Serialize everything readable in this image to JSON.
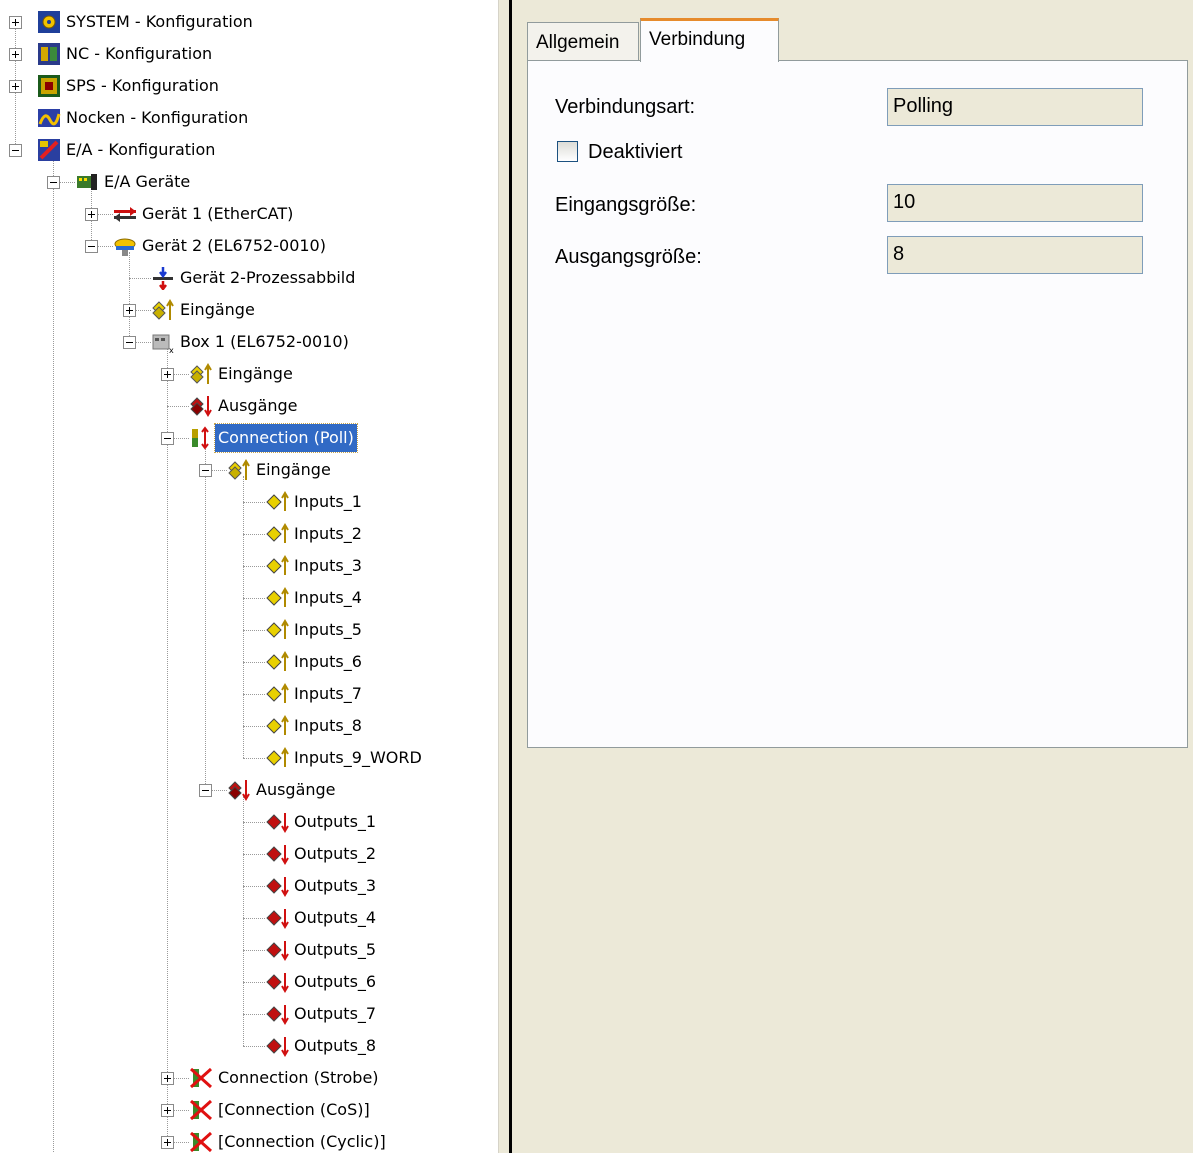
{
  "tree": {
    "items": [
      {
        "label": "SYSTEM - Konfiguration",
        "icon": "system-config-icon",
        "expander": "plus"
      },
      {
        "label": "NC - Konfiguration",
        "icon": "nc-config-icon",
        "expander": "plus"
      },
      {
        "label": "SPS - Konfiguration",
        "icon": "sps-config-icon",
        "expander": "plus"
      },
      {
        "label": "Nocken - Konfiguration",
        "icon": "cam-config-icon",
        "expander": "none"
      },
      {
        "label": "E/A - Konfiguration",
        "icon": "io-config-icon",
        "expander": "minus"
      },
      {
        "label": "E/A Geräte",
        "icon": "io-devices-icon",
        "expander": "minus"
      },
      {
        "label": "Gerät 1 (EtherCAT)",
        "icon": "ethercat-device-icon",
        "expander": "plus"
      },
      {
        "label": "Gerät 2 (EL6752-0010)",
        "icon": "devicenet-device-icon",
        "expander": "minus"
      },
      {
        "label": "Gerät 2-Prozessabbild",
        "icon": "process-image-icon",
        "expander": "none"
      },
      {
        "label": "Eingänge",
        "icon": "inputs-group-icon",
        "expander": "plus"
      },
      {
        "label": "Box 1 (EL6752-0010)",
        "icon": "box-icon",
        "expander": "minus"
      },
      {
        "label": "Eingänge",
        "icon": "inputs-group-icon",
        "expander": "plus"
      },
      {
        "label": "Ausgänge",
        "icon": "outputs-group-icon",
        "expander": "none"
      },
      {
        "label": "Connection (Poll)",
        "icon": "connection-icon",
        "expander": "minus",
        "selected": true
      },
      {
        "label": "Eingänge",
        "icon": "inputs-group-icon",
        "expander": "minus"
      },
      {
        "label": "Inputs_1",
        "icon": "input-var-icon",
        "expander": "none"
      },
      {
        "label": "Inputs_2",
        "icon": "input-var-icon",
        "expander": "none"
      },
      {
        "label": "Inputs_3",
        "icon": "input-var-icon",
        "expander": "none"
      },
      {
        "label": "Inputs_4",
        "icon": "input-var-icon",
        "expander": "none"
      },
      {
        "label": "Inputs_5",
        "icon": "input-var-icon",
        "expander": "none"
      },
      {
        "label": "Inputs_6",
        "icon": "input-var-icon",
        "expander": "none"
      },
      {
        "label": "Inputs_7",
        "icon": "input-var-icon",
        "expander": "none"
      },
      {
        "label": "Inputs_8",
        "icon": "input-var-icon",
        "expander": "none"
      },
      {
        "label": "Inputs_9_WORD",
        "icon": "input-var-icon",
        "expander": "none"
      },
      {
        "label": "Ausgänge",
        "icon": "outputs-group-icon",
        "expander": "minus"
      },
      {
        "label": "Outputs_1",
        "icon": "output-var-icon",
        "expander": "none"
      },
      {
        "label": "Outputs_2",
        "icon": "output-var-icon",
        "expander": "none"
      },
      {
        "label": "Outputs_3",
        "icon": "output-var-icon",
        "expander": "none"
      },
      {
        "label": "Outputs_4",
        "icon": "output-var-icon",
        "expander": "none"
      },
      {
        "label": "Outputs_5",
        "icon": "output-var-icon",
        "expander": "none"
      },
      {
        "label": "Outputs_6",
        "icon": "output-var-icon",
        "expander": "none"
      },
      {
        "label": "Outputs_7",
        "icon": "output-var-icon",
        "expander": "none"
      },
      {
        "label": "Outputs_8",
        "icon": "output-var-icon",
        "expander": "none"
      },
      {
        "label": "Connection (Strobe)",
        "icon": "connection-disabled-icon",
        "expander": "plus"
      },
      {
        "label": "[Connection (CoS)]",
        "icon": "connection-disabled-icon",
        "expander": "plus"
      },
      {
        "label": "[Connection (Cyclic)]",
        "icon": "connection-disabled-icon",
        "expander": "plus"
      }
    ]
  },
  "tabs": [
    {
      "label": "Allgemein",
      "active": false
    },
    {
      "label": "Verbindung",
      "active": true
    }
  ],
  "form": {
    "connection_type_label": "Verbindungsart:",
    "connection_type_value": "Polling",
    "deactivated_label": "Deaktiviert",
    "deactivated_checked": false,
    "input_size_label": "Eingangsgröße:",
    "input_size_value": "10",
    "output_size_label": "Ausgangsgröße:",
    "output_size_value": "8"
  },
  "colors": {
    "selection": "#316ac5",
    "active_tab_accent": "#e68b2c",
    "dialog_background": "#ece9d8"
  }
}
